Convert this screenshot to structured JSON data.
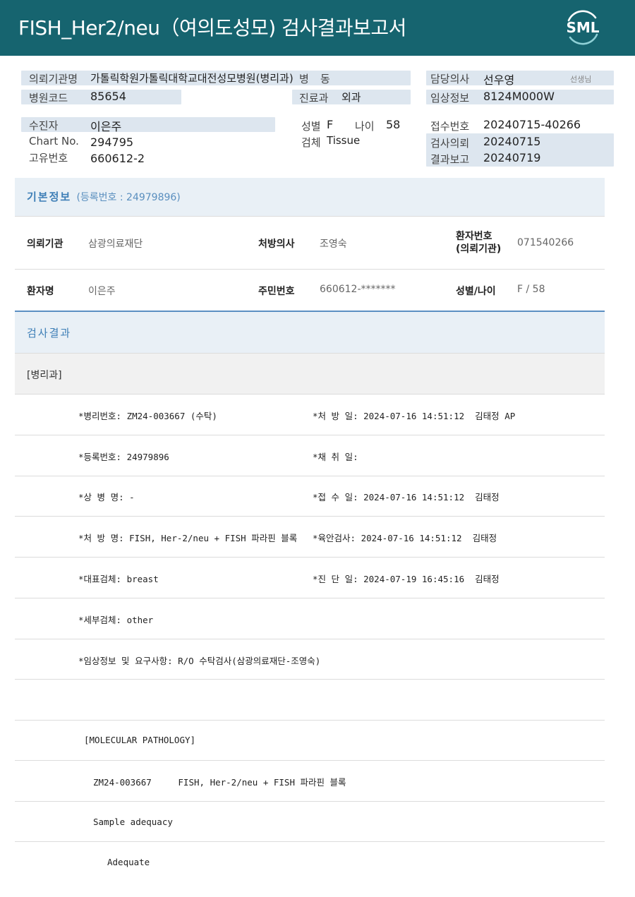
{
  "header": {
    "title": "FISH_Her2/neu（여의도성모) 검사결과보고서",
    "logo_text": "SML"
  },
  "info": {
    "req_org_label": "의뢰기관명",
    "req_org_value": "가톨릭학원가톨릭대학교대전성모병원(병리과)",
    "ward_label": "병",
    "ward_value": "동",
    "doctor_label": "담당의사",
    "doctor_value": "선우영",
    "doctor_suffix": "선생님",
    "hospital_code_label": "병원코드",
    "hospital_code_value": "85654",
    "dept_label": "진료과",
    "dept_value": "외과",
    "clinical_label": "임상정보",
    "clinical_value": "8124M000W",
    "patient_label": "수진자",
    "patient_value": "이은주",
    "sex_label": "성별",
    "sex_value": "F",
    "age_label": "나이",
    "age_value": "58",
    "receipt_label": "접수번호",
    "receipt_value": "20240715-40266",
    "chart_label": "Chart No.",
    "chart_value": "294795",
    "specimen_label": "검체",
    "specimen_value": "Tissue",
    "request_label": "검사의뢰",
    "request_value": "20240715",
    "unique_label": "고유번호",
    "unique_value": "660612-2",
    "report_label": "결과보고",
    "report_value": "20240719"
  },
  "basic": {
    "title": "기본정보",
    "subtitle": "(등록번호 : 24979896)",
    "org_label": "의뢰기관",
    "org_value": "삼광의료재단",
    "presc_label": "처방의사",
    "presc_value": "조영숙",
    "pt_no_label_1": "환자번호",
    "pt_no_label_2": "(의뢰기관)",
    "pt_no_value": "071540266",
    "name_label": "환자명",
    "name_value": "이은주",
    "rrn_label": "주민번호",
    "rrn_value": "660612-*******",
    "sexage_label": "성별/나이",
    "sexage_value": "F / 58"
  },
  "results": {
    "title": "검사결과",
    "section": "[병리과]",
    "rows": [
      {
        "left": "*병리번호: ZM24-003667 (수탁)",
        "right": "*처 방 일: 2024-07-16 14:51:12  김태정 AP"
      },
      {
        "left": "*등록번호: 24979896",
        "right": "*채 취 일:"
      },
      {
        "left": "*상 병 명: -",
        "right": "*접 수 일: 2024-07-16 14:51:12  김태정"
      },
      {
        "left": "*처 방 명: FISH, Her-2/neu + FISH 파라핀 블록",
        "right": "*육안검사: 2024-07-16 14:51:12  김태정"
      },
      {
        "left": "*대표검체: breast",
        "right": "*진 단 일: 2024-07-19 16:45:16  김태정"
      },
      {
        "left": "*세부검체: other",
        "right": ""
      },
      {
        "left": "*임상정보 및 요구사항: R/O 수탁검사(삼광의료재단-조영숙)",
        "right": ""
      }
    ],
    "mp_header": "[MOLECULAR PATHOLOGY]",
    "mp_line": "ZM24-003667     FISH, Her-2/neu + FISH 파라핀 블록",
    "adequacy_label": "Sample adequacy",
    "adequacy_value": "Adequate"
  },
  "colors": {
    "header_bg": "#16646f",
    "accent_blue": "#3d7eb6",
    "info_bar": "#dde6ef"
  }
}
